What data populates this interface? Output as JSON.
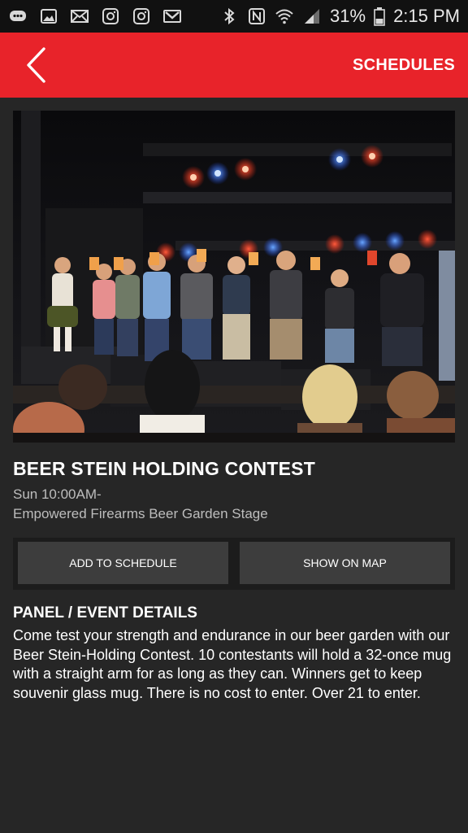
{
  "status_bar": {
    "battery": "31%",
    "time": "2:15 PM",
    "left_icons": [
      "chat-icon",
      "image-icon",
      "email-icon",
      "instagram-icon",
      "instagram-icon",
      "gmail-icon"
    ],
    "right_icons": [
      "bluetooth-icon",
      "nfc-icon",
      "wifi-icon",
      "signal-icon",
      "battery-icon"
    ]
  },
  "app_bar": {
    "back_icon": "chevron-left-icon",
    "schedules_label": "SCHEDULES",
    "color": "#e8232a"
  },
  "event": {
    "title": "BEER STEIN HOLDING CONTEST",
    "time": "Sun 10:00AM-",
    "location": "Empowered Firearms Beer Garden Stage"
  },
  "actions": {
    "add_to_schedule": "ADD TO SCHEDULE",
    "show_on_map": "SHOW ON MAP"
  },
  "details": {
    "heading": "PANEL / EVENT DETAILS",
    "body": "Come test your strength and endurance in our beer garden with our Beer Stein-Holding Contest. 10 contestants will hold a 32-once mug with a straight arm for as long as they can. Winners get to keep souvenir glass mug. There is no cost to enter. Over 21 to enter."
  }
}
